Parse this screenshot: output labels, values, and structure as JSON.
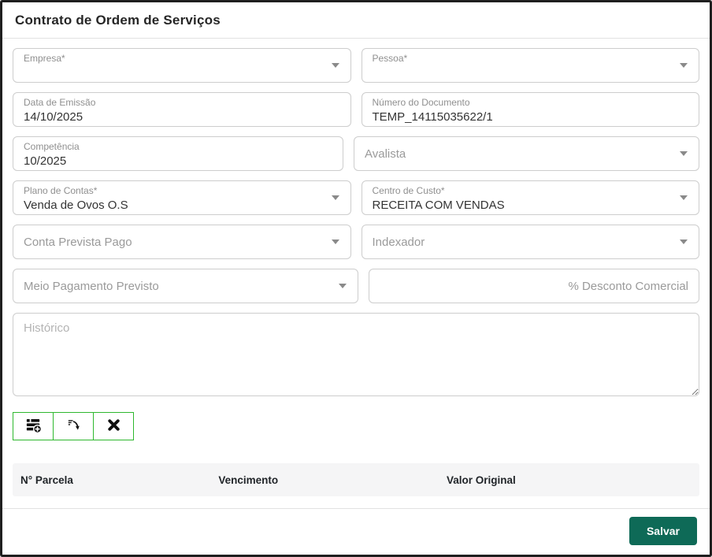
{
  "window": {
    "title": "Contrato de Ordem de Serviços"
  },
  "fields": {
    "empresa": {
      "label": "Empresa*"
    },
    "pessoa": {
      "label": "Pessoa*"
    },
    "data_emissao": {
      "label": "Data de Emissão",
      "value": "14/10/2025"
    },
    "numero_documento": {
      "label": "Número do Documento",
      "value": "TEMP_14115035622/1"
    },
    "competencia": {
      "label": "Competência",
      "value": "10/2025"
    },
    "avalista": {
      "placeholder": "Avalista"
    },
    "plano_contas": {
      "label": "Plano de Contas*",
      "value": "Venda de Ovos O.S"
    },
    "centro_custo": {
      "label": "Centro de Custo*",
      "value": "RECEITA COM VENDAS"
    },
    "conta_prevista": {
      "placeholder": "Conta Prevista Pago"
    },
    "indexador": {
      "placeholder": "Indexador"
    },
    "meio_pagamento": {
      "placeholder": "Meio Pagamento Previsto"
    },
    "desconto_comercial": {
      "placeholder": "% Desconto Comercial",
      "value": ""
    },
    "historico": {
      "placeholder": "Histórico",
      "value": ""
    }
  },
  "toolbar": {
    "buttons": [
      {
        "icon": "add-installments-icon"
      },
      {
        "icon": "generate-installments-icon"
      },
      {
        "icon": "clear-installments-icon"
      }
    ]
  },
  "table": {
    "headers": [
      "N° Parcela",
      "Vencimento",
      "Valor Original"
    ],
    "rows": []
  },
  "footer": {
    "save_label": "Salvar"
  },
  "colors": {
    "toolbar_border_green": "#2eb82e",
    "save_button_teal": "#0e6a57",
    "icon_black": "#111111"
  }
}
